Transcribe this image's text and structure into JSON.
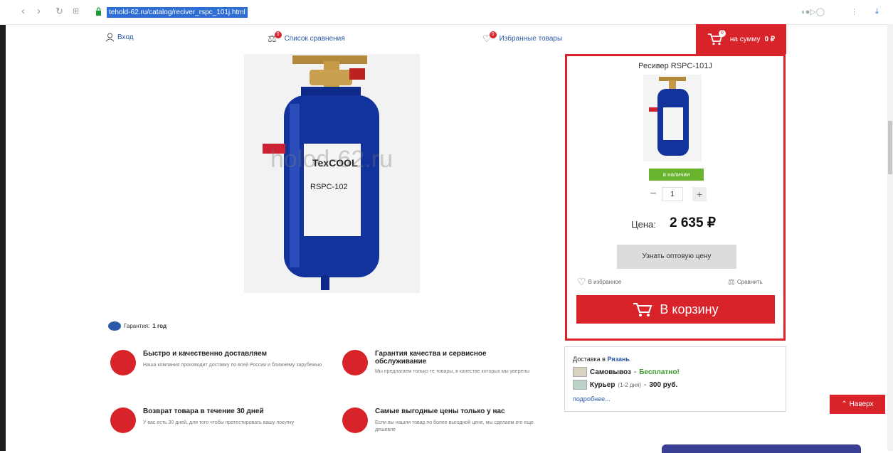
{
  "browser": {
    "url": "tehold-62.ru/catalog/reciver_rspc_101j.html"
  },
  "header": {
    "login": "Вход",
    "compare": "Список сравнения",
    "compare_count": "0",
    "favorites": "Избранные товары",
    "favorites_count": "0",
    "cart_prefix": "на сумму",
    "cart_sum": "0 ₽",
    "cart_count": "0"
  },
  "product": {
    "watermark": "holod-62.ru",
    "title": "Ресивер RSPC-101J",
    "stock": "в наличии",
    "qty": "1",
    "price_label": "Цена:",
    "price": "2 635 ₽",
    "wholesale_btn": "Узнать оптовую цену",
    "fav_label": "В избранное",
    "compare_label": "Сравнить",
    "cart_btn": "В корзину"
  },
  "delivery": {
    "prefix": "Доставка в",
    "city": "Рязань",
    "pickup_label": "Самовывоз",
    "pickup_price": "Бесплатно!",
    "courier_label": "Курьер",
    "courier_days": "(1-2 дня)",
    "courier_price": "300 руб.",
    "more": "подробнее..."
  },
  "warranty": {
    "label": "Гарантия:",
    "value": "1 год"
  },
  "features": [
    {
      "title": "Быстро и качественно доставляем",
      "text": "Наша компания производит доставку по всей России и ближнему зарубежью"
    },
    {
      "title": "Гарантия качества и сервисное обслуживание",
      "text": "Мы предлагаем только те товары, в качестве которых мы уверены"
    },
    {
      "title": "Возврат товара в течение 30 дней",
      "text": "У вас есть 30 дней, для того чтобы протестировать вашу покупку"
    },
    {
      "title": "Самые выгодные цены только у нас",
      "text": "Если вы нашли товар по более выгодной цене, мы сделаем его еще дешевле"
    }
  ],
  "up_button": "Наверх",
  "colors": {
    "accent": "#d8232a",
    "stock": "#6ab42d",
    "link": "#2a5aa8"
  }
}
